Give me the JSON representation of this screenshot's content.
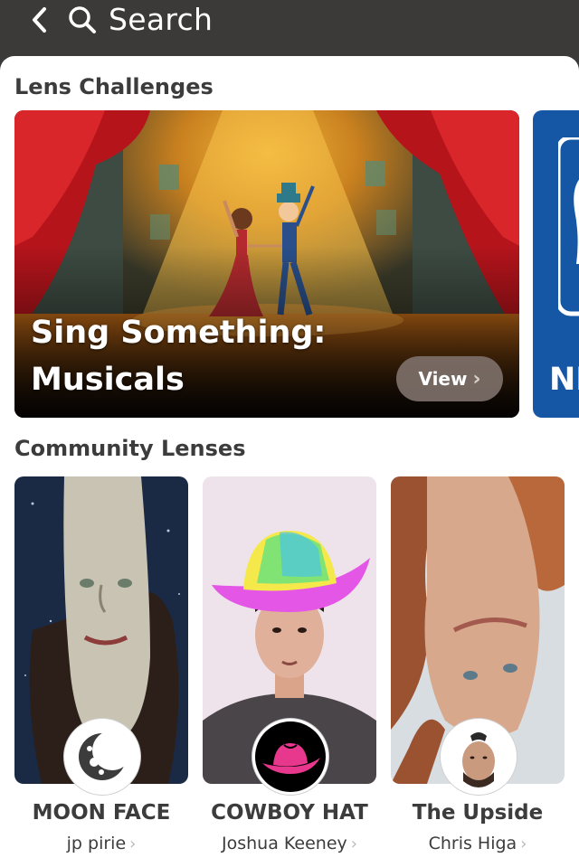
{
  "header": {
    "search_label": "Search"
  },
  "challenges": {
    "title": "Lens Challenges",
    "cards": [
      {
        "title": "Sing Something: Musicals",
        "button": "View"
      },
      {
        "title": "NBA"
      }
    ]
  },
  "community": {
    "title": "Community Lenses",
    "lenses": [
      {
        "name": "MOON FACE",
        "author": "jp pirie"
      },
      {
        "name": "COWBOY HAT",
        "author": "Joshua Keeney"
      },
      {
        "name": "The Upside",
        "author": "Chris Higa"
      }
    ]
  },
  "colors": {
    "topbar": "#3b3a39",
    "sheet": "#ffffff",
    "text": "#3c3c3c",
    "view_button": "#7d7069",
    "card2": "#1557a5"
  },
  "icons": [
    "back-chevron-icon",
    "search-icon",
    "chevron-right-icon",
    "moon-icon",
    "cowboy-hat-icon"
  ]
}
